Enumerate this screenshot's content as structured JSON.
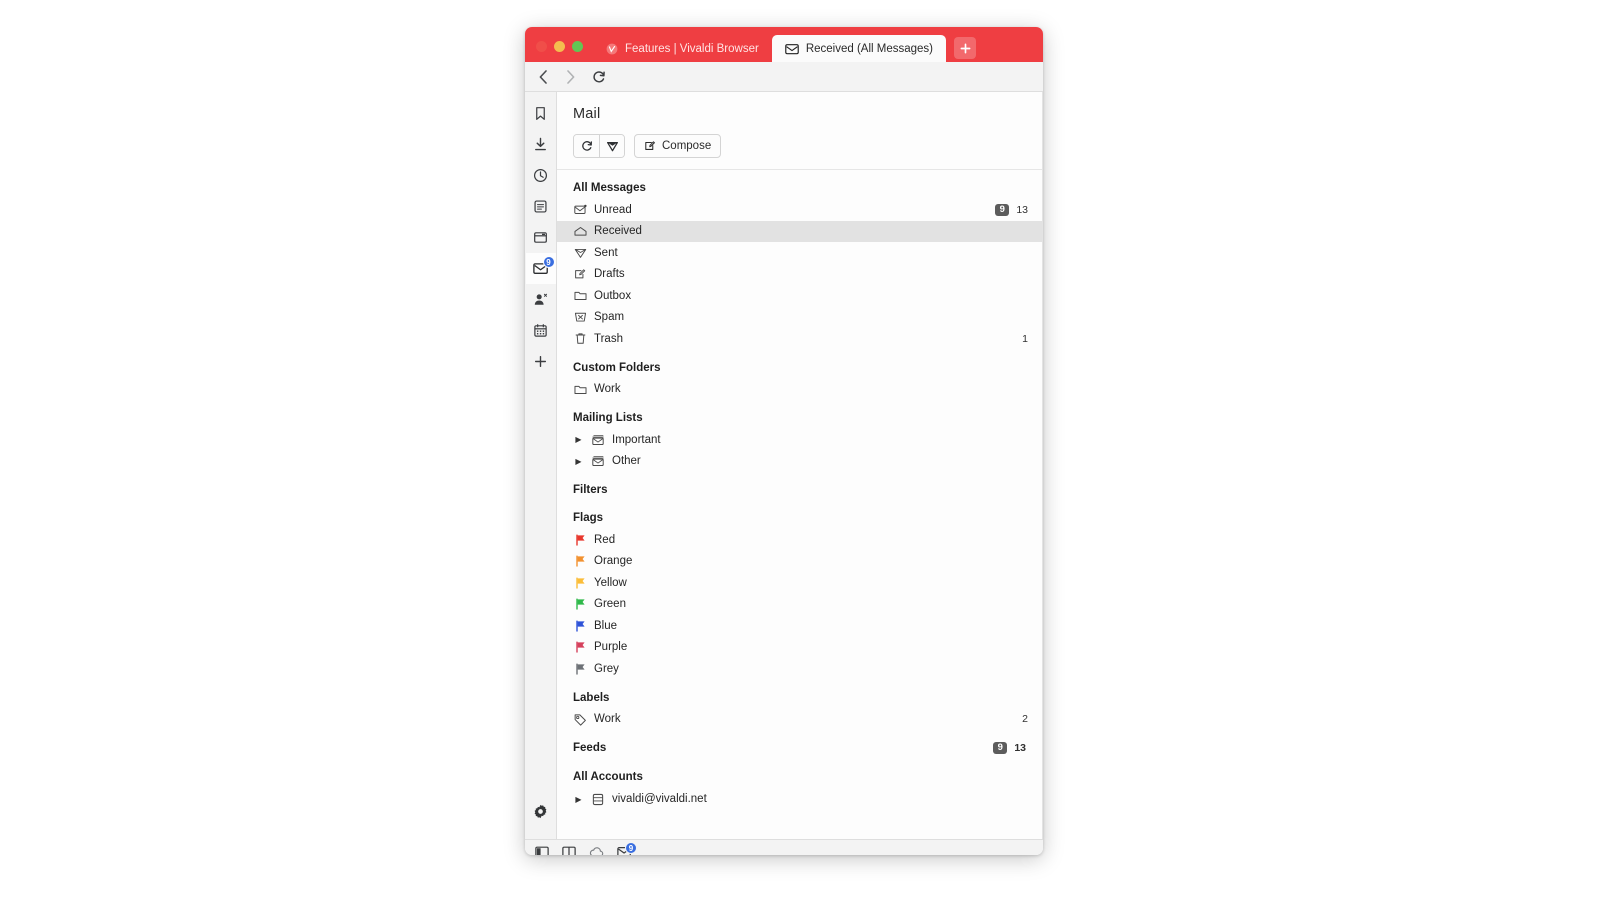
{
  "window": {
    "traffic_lights": [
      "close",
      "minimize",
      "zoom"
    ],
    "tabs": [
      {
        "label": "Features | Vivaldi Browser",
        "icon": "vivaldi-logo-icon",
        "active": false
      },
      {
        "label": "Received (All Messages)",
        "icon": "mail-envelope-icon",
        "active": true
      }
    ],
    "new_tab_label": "+",
    "accent_color": "#ef3e42"
  },
  "navbar": {
    "back_label": "Back",
    "forward_label": "Forward",
    "reload_label": "Reload"
  },
  "rail": {
    "items": [
      {
        "name": "bookmarks",
        "label": "Bookmarks",
        "icon": "bookmark-icon",
        "active": false,
        "badge": ""
      },
      {
        "name": "downloads",
        "label": "Downloads",
        "icon": "download-icon",
        "active": false,
        "badge": ""
      },
      {
        "name": "history",
        "label": "History",
        "icon": "clock-icon",
        "active": false,
        "badge": ""
      },
      {
        "name": "notes",
        "label": "Notes",
        "icon": "notes-icon",
        "active": false,
        "badge": ""
      },
      {
        "name": "windows",
        "label": "Windows",
        "icon": "window-icon",
        "active": false,
        "badge": ""
      },
      {
        "name": "mail",
        "label": "Mail",
        "icon": "mail-icon",
        "active": true,
        "badge": "9"
      },
      {
        "name": "contacts",
        "label": "Contacts",
        "icon": "contacts-icon",
        "active": false,
        "badge": ""
      },
      {
        "name": "calendar",
        "label": "Calendar",
        "icon": "calendar-icon",
        "active": false,
        "badge": ""
      },
      {
        "name": "add-panel",
        "label": "+",
        "icon": "plus-icon",
        "active": false,
        "badge": ""
      }
    ],
    "settings_label": "Settings"
  },
  "panel": {
    "title": "Mail",
    "toolbar": {
      "refresh_label": "Refresh",
      "mark_read_label": "Mark as Read",
      "compose_label": "Compose"
    },
    "sections": [
      {
        "heading": "All Messages",
        "unread_badge": "",
        "total_count": "",
        "rows": [
          {
            "label": "Unread",
            "icon": "mail-unread-icon",
            "selected": false,
            "unread": "9",
            "total": "13"
          },
          {
            "label": "Received",
            "icon": "inbox-open-icon",
            "selected": true,
            "unread": "",
            "total": ""
          },
          {
            "label": "Sent",
            "icon": "send-icon",
            "selected": false,
            "unread": "",
            "total": ""
          },
          {
            "label": "Drafts",
            "icon": "draft-pencil-icon",
            "selected": false,
            "unread": "",
            "total": ""
          },
          {
            "label": "Outbox",
            "icon": "folder-icon",
            "selected": false,
            "unread": "",
            "total": ""
          },
          {
            "label": "Spam",
            "icon": "spam-icon",
            "selected": false,
            "unread": "",
            "total": ""
          },
          {
            "label": "Trash",
            "icon": "trash-icon",
            "selected": false,
            "unread": "",
            "total": "1"
          }
        ]
      },
      {
        "heading": "Custom Folders",
        "unread_badge": "",
        "total_count": "",
        "rows": [
          {
            "label": "Work",
            "icon": "folder-icon",
            "selected": false,
            "unread": "",
            "total": ""
          }
        ]
      },
      {
        "heading": "Mailing Lists",
        "unread_badge": "",
        "total_count": "",
        "rows": [
          {
            "label": "Important",
            "icon": "mailing-list-icon",
            "twisty": true,
            "selected": false,
            "unread": "",
            "total": ""
          },
          {
            "label": "Other",
            "icon": "mailing-list-icon",
            "twisty": true,
            "selected": false,
            "unread": "",
            "total": ""
          }
        ]
      },
      {
        "heading": "Filters",
        "unread_badge": "",
        "total_count": "",
        "rows": []
      },
      {
        "heading": "Flags",
        "unread_badge": "",
        "total_count": "",
        "rows": [
          {
            "label": "Red",
            "icon": "flag-icon",
            "color": "#e8372c",
            "selected": false,
            "unread": "",
            "total": ""
          },
          {
            "label": "Orange",
            "icon": "flag-icon",
            "color": "#f2912f",
            "selected": false,
            "unread": "",
            "total": ""
          },
          {
            "label": "Yellow",
            "icon": "flag-icon",
            "color": "#fbbd38",
            "selected": false,
            "unread": "",
            "total": ""
          },
          {
            "label": "Green",
            "icon": "flag-icon",
            "color": "#2fb94a",
            "selected": false,
            "unread": "",
            "total": ""
          },
          {
            "label": "Blue",
            "icon": "flag-icon",
            "color": "#2e53d8",
            "selected": false,
            "unread": "",
            "total": ""
          },
          {
            "label": "Purple",
            "icon": "flag-icon",
            "color": "#d5415c",
            "selected": false,
            "unread": "",
            "total": ""
          },
          {
            "label": "Grey",
            "icon": "flag-icon",
            "color": "#6d7176",
            "selected": false,
            "unread": "",
            "total": ""
          }
        ]
      },
      {
        "heading": "Labels",
        "unread_badge": "",
        "total_count": "",
        "rows": [
          {
            "label": "Work",
            "icon": "tag-icon",
            "selected": false,
            "unread": "",
            "total": "2"
          }
        ]
      },
      {
        "heading": "Feeds",
        "unread_badge": "9",
        "total_count": "13",
        "rows": []
      },
      {
        "heading": "All Accounts",
        "unread_badge": "",
        "total_count": "",
        "rows": [
          {
            "label": "vivaldi@vivaldi.net",
            "icon": "account-db-icon",
            "twisty": true,
            "selected": false,
            "unread": "",
            "total": ""
          }
        ]
      }
    ]
  },
  "statusbar": {
    "items": [
      {
        "name": "panel-toggle",
        "label": "Toggle Panel",
        "icon": "panel-toggle-icon",
        "badge": ""
      },
      {
        "name": "tiling",
        "label": "Page Tiling",
        "icon": "tile-icon",
        "badge": ""
      },
      {
        "name": "sync",
        "label": "Sync",
        "icon": "cloud-icon",
        "badge": ""
      },
      {
        "name": "mail-status",
        "label": "Mail",
        "icon": "mail-icon",
        "badge": "9"
      }
    ]
  }
}
